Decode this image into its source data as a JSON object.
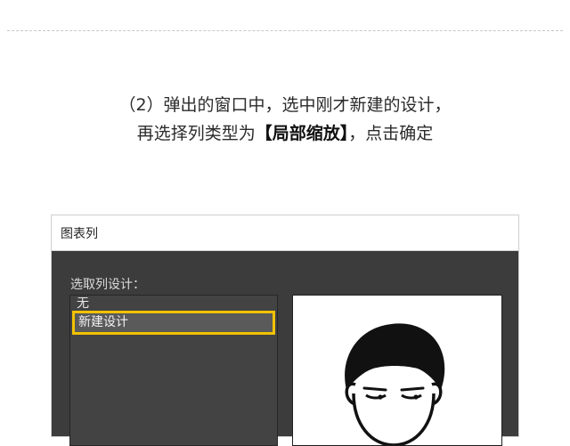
{
  "instruction": {
    "line1": "（2）弹出的窗口中，选中刚才新建的设计，",
    "line2_prefix": "再选择列类型为",
    "line2_bold": "【局部缩放】",
    "line2_suffix": "，点击确定"
  },
  "dialog": {
    "title": "图表列",
    "select_label": "选取列设计：",
    "items": [
      "无",
      "新建设计"
    ],
    "selected_index": 1,
    "preview_icon": "cartoon-face-icon"
  },
  "colors": {
    "dialog_bg": "#3c3c3c",
    "highlight": "#f2c200"
  }
}
